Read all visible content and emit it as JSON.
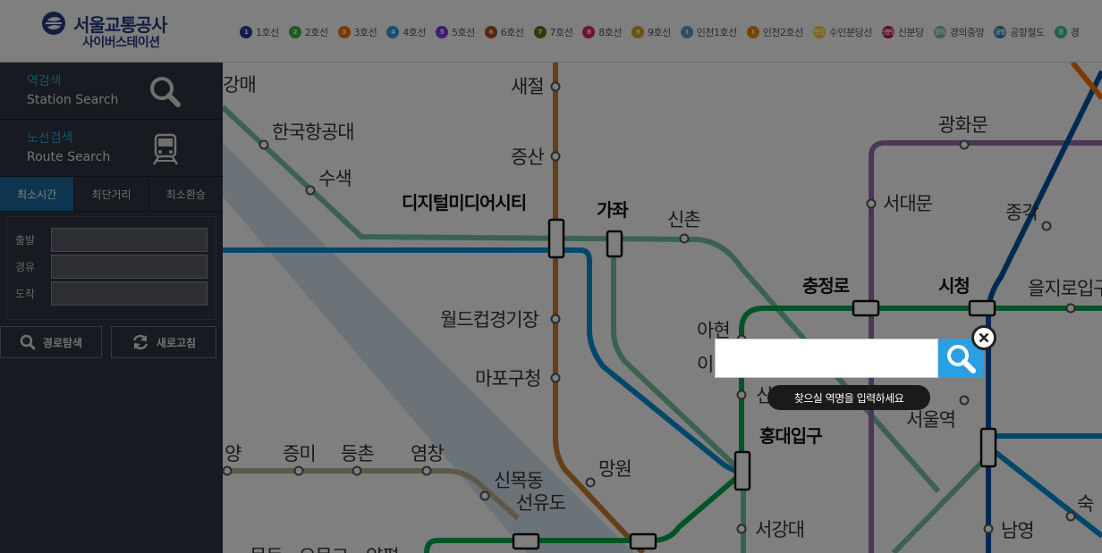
{
  "header": {
    "logo_title": "서울교통공사",
    "logo_subtitle": "사이버스테이션",
    "lines": [
      {
        "num": "1",
        "label": "1호선",
        "color": "#263c96"
      },
      {
        "num": "2",
        "label": "2호선",
        "color": "#3cb44a"
      },
      {
        "num": "3",
        "label": "3호선",
        "color": "#ff7300"
      },
      {
        "num": "4",
        "label": "4호선",
        "color": "#2c9ede"
      },
      {
        "num": "5",
        "label": "5호선",
        "color": "#8936e0"
      },
      {
        "num": "6",
        "label": "6호선",
        "color": "#b5500b"
      },
      {
        "num": "7",
        "label": "7호선",
        "color": "#697215"
      },
      {
        "num": "8",
        "label": "8호선",
        "color": "#e51e6e"
      },
      {
        "num": "9",
        "label": "9호선",
        "color": "#d1a62c"
      },
      {
        "num": "I",
        "label": "인천1호선",
        "color": "#6e98bb"
      },
      {
        "num": "I",
        "label": "인천2호선",
        "color": "#ed8b00"
      },
      {
        "num": "분당",
        "label": "수인분당선",
        "color": "#ffcd12"
      },
      {
        "num": "신분당",
        "label": "신분당",
        "color": "#d31145"
      },
      {
        "num": "경의",
        "label": "경의중앙",
        "color": "#73c7a6"
      },
      {
        "num": "공항",
        "label": "공항철도",
        "color": "#3681b7"
      },
      {
        "num": "경",
        "label": "경",
        "color": "#32c6a6"
      }
    ]
  },
  "sidebar": {
    "station_search_ko": "역검색",
    "station_search_en": "Station Search",
    "route_search_ko": "노선검색",
    "route_search_en": "Route Search",
    "tabs": [
      "최소시간",
      "최단거리",
      "최소환승"
    ],
    "active_tab": "최소시간",
    "fields": [
      {
        "label": "출발",
        "value": ""
      },
      {
        "label": "경유",
        "value": ""
      },
      {
        "label": "도착",
        "value": ""
      }
    ],
    "search_button": "경로탐색",
    "refresh_button": "새로고침"
  },
  "map": {
    "stations": [
      "새절",
      "증산",
      "강매",
      "한국항공대",
      "수색",
      "디지털미디어시티",
      "가좌",
      "신촌",
      "광화문",
      "서대문",
      "종각",
      "충정로",
      "시청",
      "을지로입구",
      "월드컵경기장",
      "마포구청",
      "아현",
      "이",
      "신",
      "서울역",
      "홍대입구",
      "망원",
      "신목동",
      "선유도",
      "양",
      "증미",
      "등촌",
      "염창",
      "서강대",
      "남영",
      "숙",
      "목동",
      "오목교",
      "양평"
    ]
  },
  "search_popup": {
    "input_value": "",
    "hint": "찾으실 역명을 입력하세요"
  }
}
